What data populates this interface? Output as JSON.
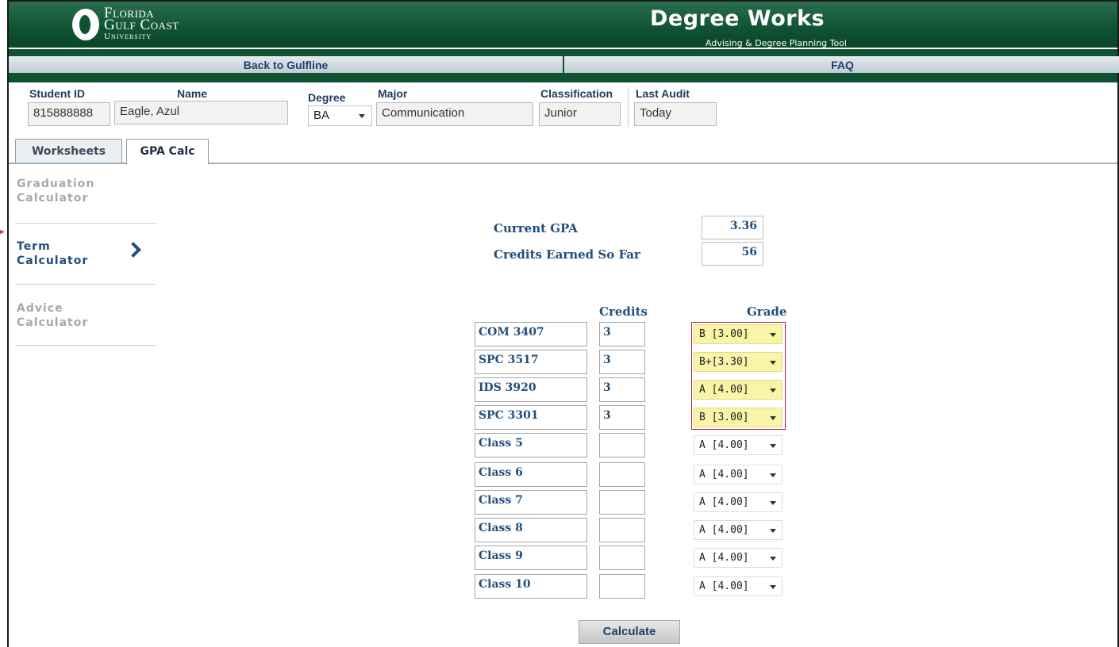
{
  "header": {
    "logo_line1": "Florida",
    "logo_line2": "Gulf Coast",
    "logo_line3": "University",
    "brand_title": "Degree Works",
    "brand_subtitle": "Advising & Degree Planning Tool"
  },
  "nav": {
    "back": "Back to Gulfline",
    "faq": "FAQ"
  },
  "student": {
    "student_id_label": "Student ID",
    "student_id": "815888888",
    "name_label": "Name",
    "name": "Eagle, Azul",
    "degree_label": "Degree",
    "degree": "BA",
    "major_label": "Major",
    "major": "Communication",
    "classification_label": "Classification",
    "classification": "Junior",
    "last_audit_label": "Last Audit",
    "last_audit": "Today"
  },
  "tabs": [
    {
      "label": "Worksheets",
      "active": false
    },
    {
      "label": "GPA Calc",
      "active": true
    }
  ],
  "menu": [
    {
      "line1": "Graduation",
      "line2": "Calculator",
      "active": false
    },
    {
      "line1": "Term",
      "line2": "Calculator",
      "active": true
    },
    {
      "line1": "Advice",
      "line2": "Calculator",
      "active": false
    }
  ],
  "summary": {
    "current_gpa_label": "Current GPA",
    "current_gpa": "3.36",
    "credits_label": "Credits Earned So Far",
    "credits": "56"
  },
  "columns": {
    "credits": "Credits",
    "grade": "Grade"
  },
  "rows": [
    {
      "class": "COM 3407",
      "credits": "3",
      "grade": "B [3.00]"
    },
    {
      "class": "SPC 3517",
      "credits": "3",
      "grade": "B+[3.30]"
    },
    {
      "class": "IDS 3920",
      "credits": "3",
      "grade": "A [4.00]"
    },
    {
      "class": "SPC 3301",
      "credits": "3",
      "grade": "B [3.00]"
    },
    {
      "class": "Class 5",
      "credits": "",
      "grade": "A [4.00]"
    },
    {
      "class": "Class 6",
      "credits": "",
      "grade": "A [4.00]"
    },
    {
      "class": "Class 7",
      "credits": "",
      "grade": "A [4.00]"
    },
    {
      "class": "Class 8",
      "credits": "",
      "grade": "A [4.00]"
    },
    {
      "class": "Class 9",
      "credits": "",
      "grade": "A [4.00]"
    },
    {
      "class": "Class 10",
      "credits": "",
      "grade": "A [4.00]"
    }
  ],
  "calculate_label": "Calculate"
}
